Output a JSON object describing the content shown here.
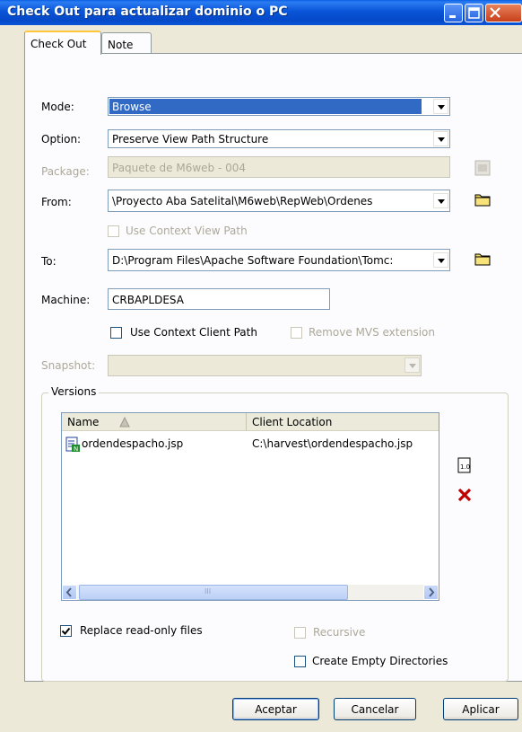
{
  "window": {
    "title": "Check Out para actualizar dominio o PC"
  },
  "tabs": [
    {
      "label": "Check Out"
    },
    {
      "label": "Note"
    }
  ],
  "form": {
    "mode": {
      "label": "Mode:",
      "value": "Browse"
    },
    "option": {
      "label": "Option:",
      "value": "Preserve View Path Structure"
    },
    "package": {
      "label": "Package:",
      "value": "Paquete de M6web -  004"
    },
    "from": {
      "label": "From:",
      "value": "\\Proyecto Aba Satelital\\M6web\\RepWeb\\Ordenes"
    },
    "use_context_view_path": {
      "label": "Use Context View Path",
      "checked": false
    },
    "to": {
      "label": "To:",
      "value": "D:\\Program Files\\Apache Software Foundation\\Tomc:"
    },
    "machine": {
      "label": "Machine:",
      "value": "CRBAPLDESA"
    },
    "use_context_client_path": {
      "label": "Use Context Client Path",
      "checked": false
    },
    "remove_mvs_extension": {
      "label": "Remove MVS extension",
      "checked": false
    },
    "snapshot": {
      "label": "Snapshot:",
      "value": ""
    }
  },
  "versions": {
    "title": "Versions",
    "columns": [
      "Name",
      "Client Location"
    ],
    "rows": [
      {
        "name": "ordendespacho.jsp",
        "location": "C:\\harvest\\ordendespacho.jsp"
      }
    ],
    "scroll_grip": "III"
  },
  "options": {
    "replace_read_only": {
      "label": "Replace read-only files",
      "checked": true
    },
    "recursive": {
      "label": "Recursive",
      "checked": false
    },
    "create_empty_dirs": {
      "label": "Create Empty Directories",
      "checked": false
    }
  },
  "buttons": {
    "ok": "Aceptar",
    "cancel": "Cancelar",
    "apply": "Aplicar"
  },
  "colors": {
    "titlebar": "#0a55d8",
    "selection": "#316ac5",
    "delete_icon": "#c00000",
    "folder_icon": "#f2d85a"
  }
}
